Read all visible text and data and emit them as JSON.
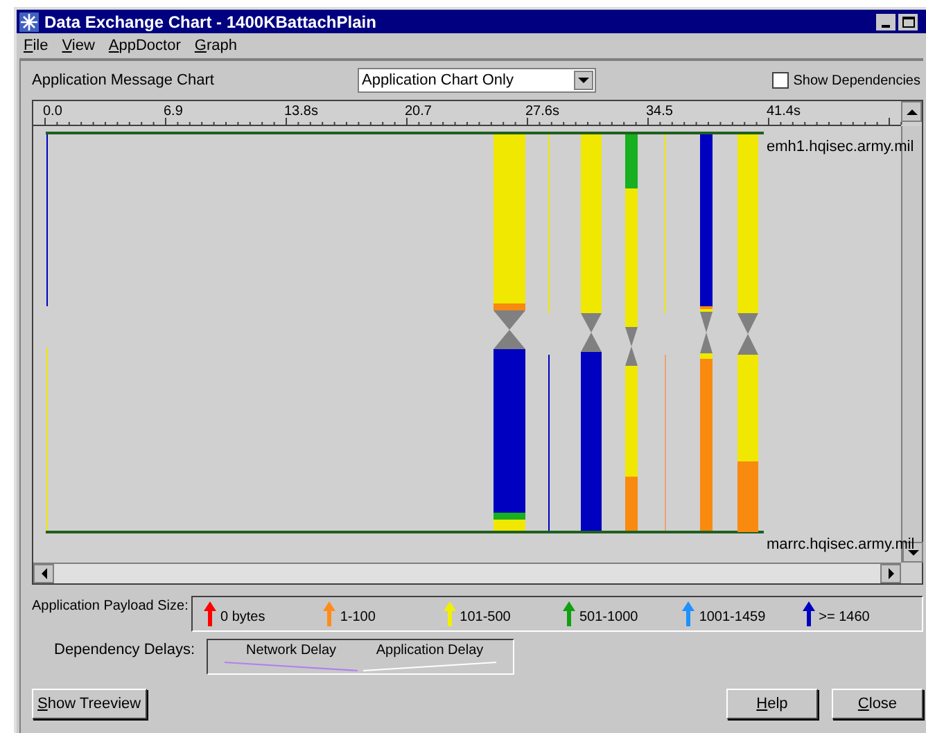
{
  "window": {
    "title": "Data Exchange Chart - 1400KBattachPlain"
  },
  "menu": [
    {
      "label": "File"
    },
    {
      "label": "View"
    },
    {
      "label": "AppDoctor"
    },
    {
      "label": "Graph"
    }
  ],
  "chart_header": {
    "label": "Application Message Chart",
    "view_select": {
      "value": "Application Chart Only"
    },
    "show_dependencies": {
      "label": "Show Dependencies",
      "checked": false
    }
  },
  "time_ruler": [
    "0.0",
    "6.9",
    "13.8s",
    "20.7",
    "27.6s",
    "34.5",
    "41.4s"
  ],
  "hosts": {
    "top": "emh1.hqisec.army.mil",
    "bottom": "marrc.hqisec.army.mil"
  },
  "payload_legend": {
    "label": "Application Payload Size:",
    "items": [
      {
        "label": "0 bytes",
        "color": "#ff0000"
      },
      {
        "label": "1-100",
        "color": "#ff8c1a"
      },
      {
        "label": "101-500",
        "color": "#f0f000"
      },
      {
        "label": "501-1000",
        "color": "#10a010"
      },
      {
        "label": "1001-1459",
        "color": "#1e90ff"
      },
      {
        "label": ">= 1460",
        "color": "#0000c0"
      }
    ]
  },
  "delay_legend": {
    "label": "Dependency Delays:",
    "items": [
      {
        "label": "Network Delay",
        "color": "#b080f0"
      },
      {
        "label": "Application Delay",
        "color": "#ffffff"
      }
    ]
  },
  "buttons": {
    "left": "Show Treeview",
    "right": [
      "Help",
      "Close"
    ]
  }
}
